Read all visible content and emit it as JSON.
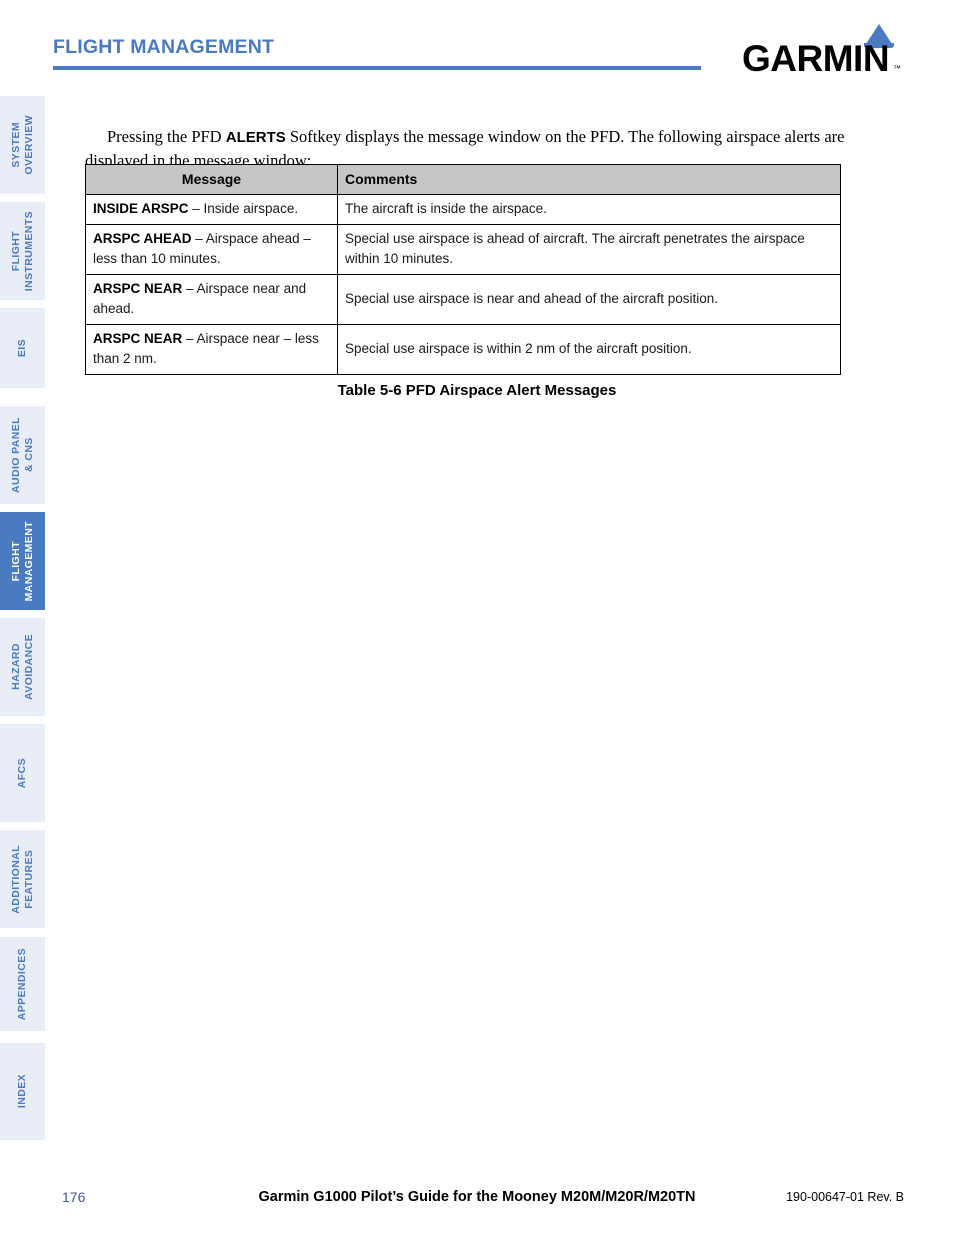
{
  "header": {
    "chapter_title": "FLIGHT MANAGEMENT",
    "rule_color": "#4a7ac0"
  },
  "logo": {
    "wordmark": "GARMIN",
    "trademark": "™",
    "triangle_color": "#4a7ac0"
  },
  "sidebar": {
    "active_index": 4,
    "tabs": [
      {
        "label": "SYSTEM\nOVERVIEW",
        "active": false
      },
      {
        "label": "FLIGHT\nINSTRUMENTS",
        "active": false
      },
      {
        "label": "EIS",
        "active": false
      },
      {
        "label": "AUDIO PANEL\n& CNS",
        "active": false
      },
      {
        "label": "FLIGHT\nMANAGEMENT",
        "active": true
      },
      {
        "label": "HAZARD\nAVOIDANCE",
        "active": false
      },
      {
        "label": "AFCS",
        "active": false
      },
      {
        "label": "ADDITIONAL\nFEATURES",
        "active": false
      },
      {
        "label": "APPENDICES",
        "active": false
      },
      {
        "label": "INDEX",
        "active": false
      }
    ]
  },
  "body": {
    "paragraph_part1": "Pressing the PFD ",
    "paragraph_softkey": "ALERTS",
    "paragraph_part2": " Softkey displays the message window on the PFD. The following airspace alerts are displayed in the message window:"
  },
  "table": {
    "headers": [
      "Message",
      "Comments"
    ],
    "rows": [
      {
        "message_code": "INSIDE ARSPC",
        "message_rest": " – Inside airspace.",
        "comment": "The aircraft is inside the airspace."
      },
      {
        "message_code": "ARSPC AHEAD",
        "message_rest": " – Airspace ahead – less than 10 minutes.",
        "comment": "Special use airspace is ahead of aircraft.  The aircraft penetrates the airspace within 10 minutes."
      },
      {
        "message_code": "ARSPC NEAR",
        "message_rest": " – Airspace near and ahead.",
        "comment": "Special use airspace is near and ahead of the aircraft position."
      },
      {
        "message_code": "ARSPC NEAR",
        "message_rest": " – Airspace near – less than 2 nm.",
        "comment": "Special use airspace is within 2 nm of the aircraft position."
      }
    ],
    "caption": "Table 5-6  PFD Airspace Alert Messages"
  },
  "footer": {
    "page_number": "176",
    "title": "Garmin G1000 Pilot’s Guide for the Mooney M20M/M20R/M20TN",
    "part_number": "190-00647-01  Rev. B"
  }
}
